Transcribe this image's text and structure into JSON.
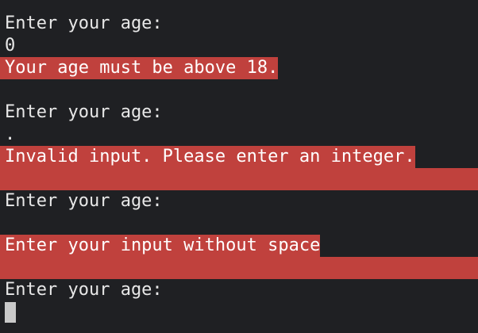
{
  "terminal": {
    "lines": [
      {
        "type": "prompt",
        "text": "Enter your age:"
      },
      {
        "type": "input",
        "text": "0"
      },
      {
        "type": "error",
        "text": "Your age must be above 18."
      },
      {
        "type": "prompt",
        "text": "Enter your age:"
      },
      {
        "type": "input",
        "text": "."
      },
      {
        "type": "error",
        "text": "Invalid input. Please enter an integer."
      },
      {
        "type": "prompt",
        "text": "Enter your age:"
      },
      {
        "type": "error",
        "text": "Enter your input without space"
      },
      {
        "type": "prompt",
        "text": "Enter your age:"
      }
    ],
    "colors": {
      "background": "#1f2023",
      "text": "#e8e8e8",
      "error_background": "#c0413d",
      "cursor": "#c9c9c9"
    }
  }
}
